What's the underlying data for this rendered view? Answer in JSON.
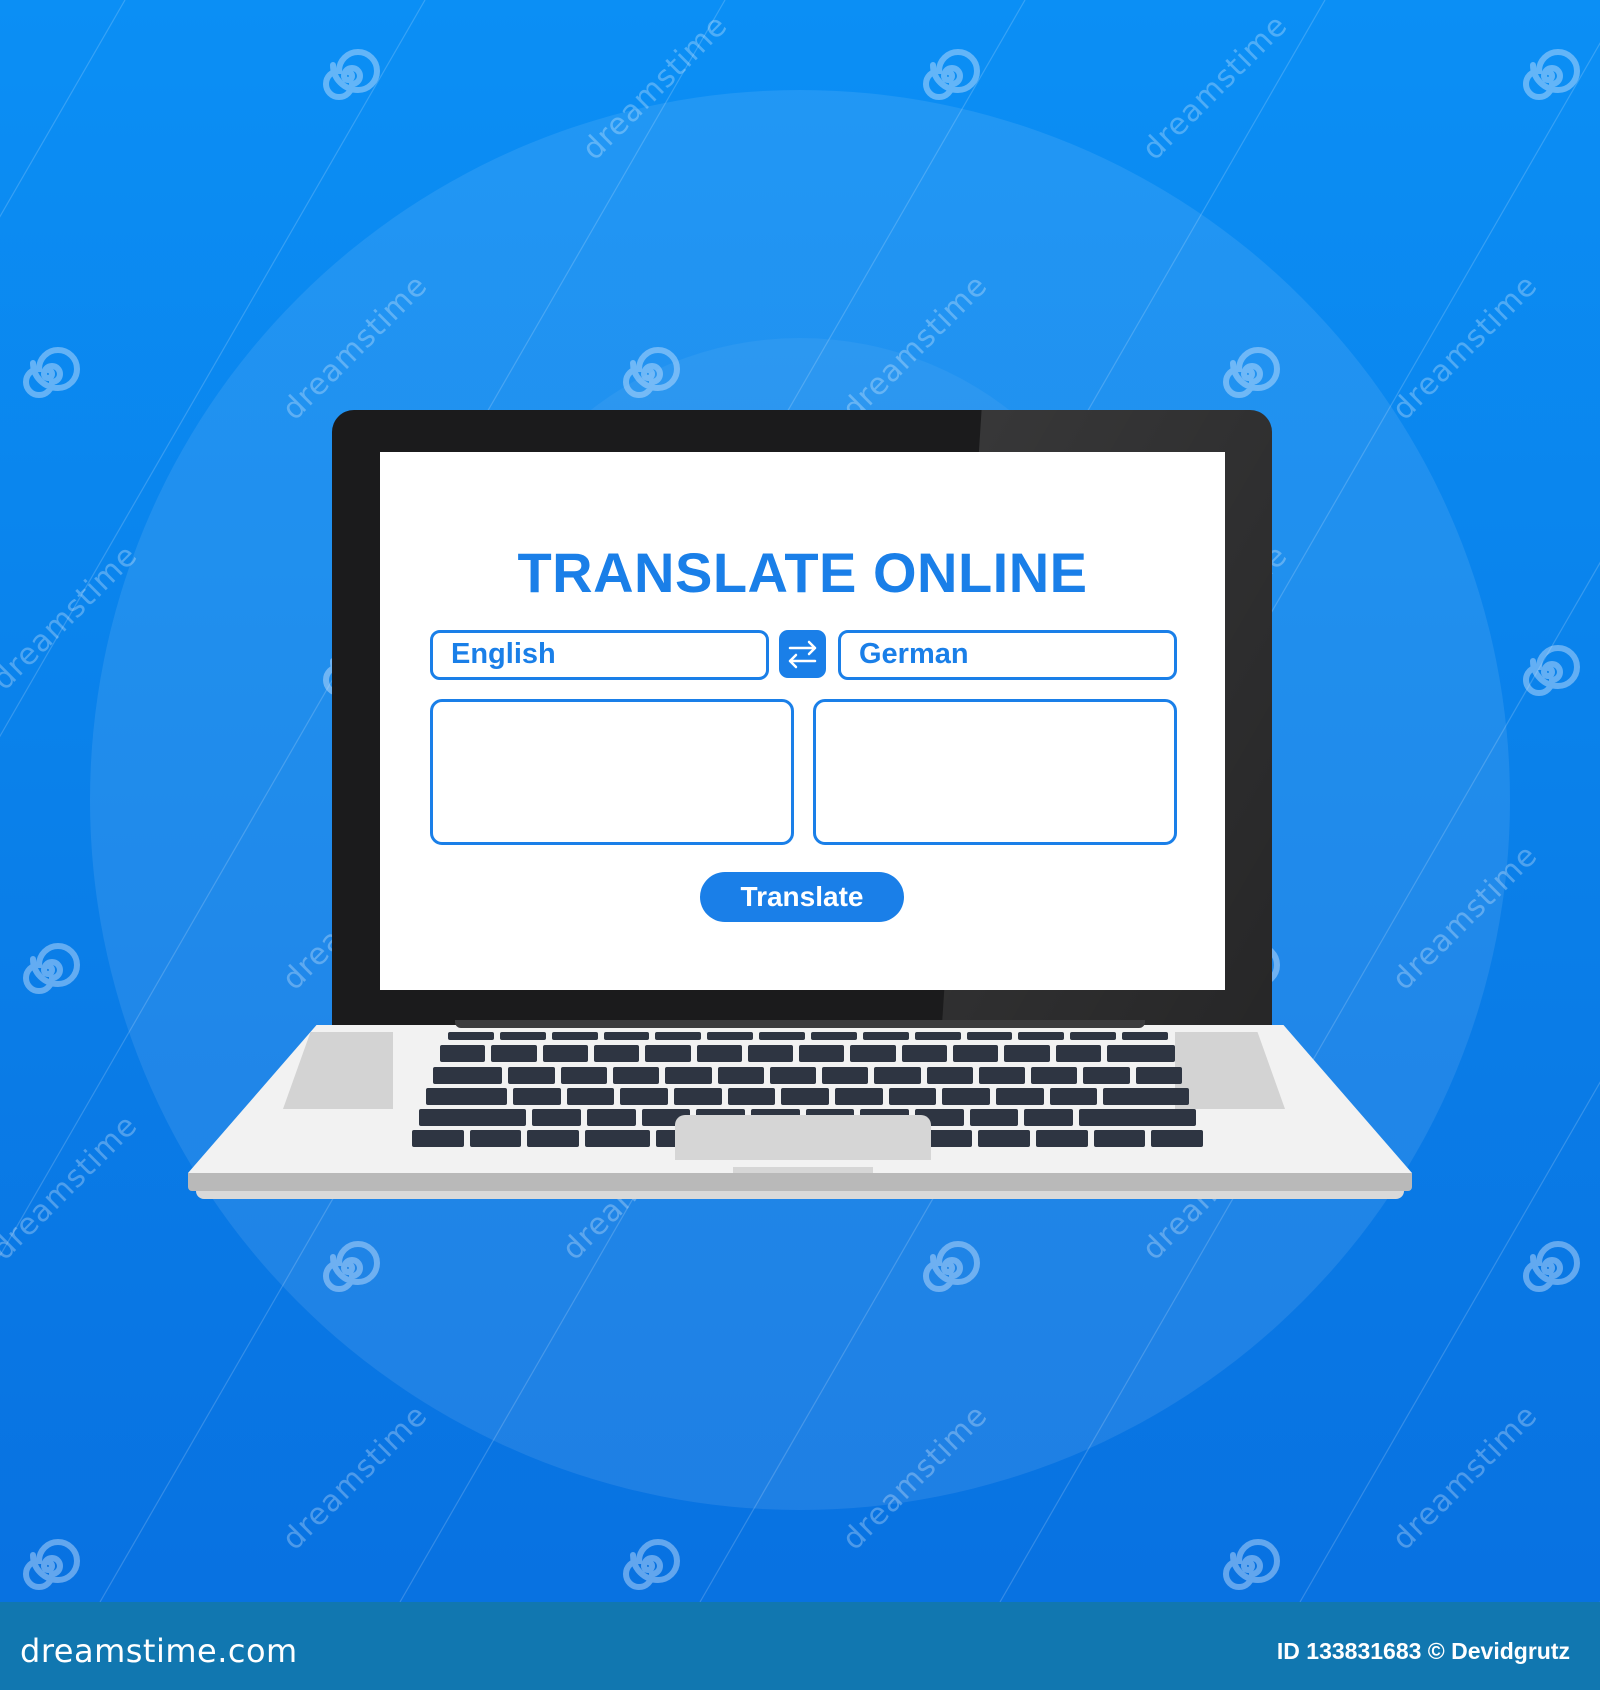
{
  "app": {
    "title": "TRANSLATE ONLINE",
    "source_language": "English",
    "target_language": "German",
    "swap_icon": "swap-arrows-icon",
    "source_text": "",
    "target_text": "",
    "translate_button": "Translate"
  },
  "colors": {
    "accent": "#1a7fe8",
    "background": "#0a7ee8",
    "footer": "#1177b0",
    "bezel": "#1b1b1c",
    "keys": "#2e3542"
  },
  "watermark": {
    "text": "dreamstime",
    "spiral_icon": "dreamstime-spiral-icon"
  },
  "footer": {
    "logo": "dreamstime.com",
    "credit": "ID 133831683 © Devidgrutz"
  }
}
